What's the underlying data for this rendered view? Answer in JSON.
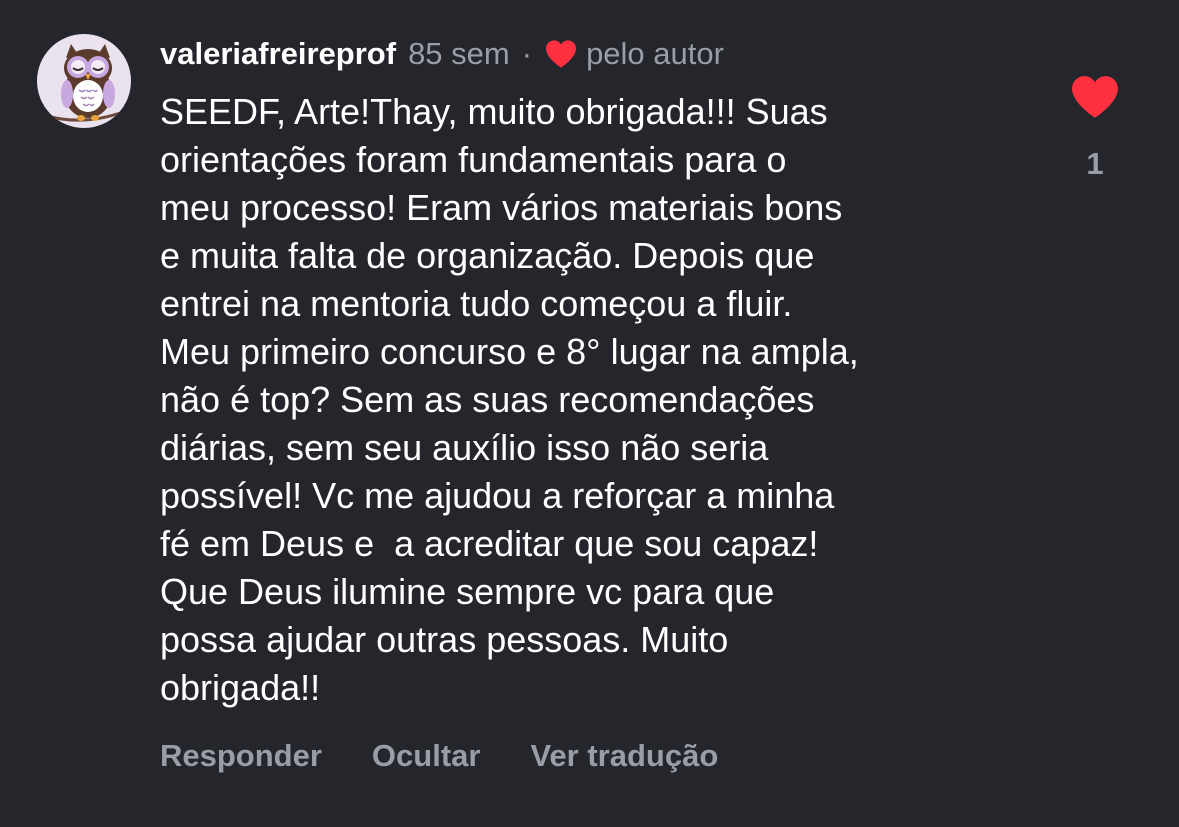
{
  "comment": {
    "username": "valeriafreireprof",
    "time": "85 sem",
    "separator": "·",
    "liked_by_author_label": "pelo autor",
    "text": "SEEDF, Arte!Thay, muito obrigada!!! Suas\norientações foram fundamentais para o\nmeu processo! Eram vários materiais bons\ne muita falta de organização. Depois que\nentrei na mentoria tudo começou a fluir.\nMeu primeiro concurso e 8° lugar na ampla,\nnão é top? Sem as suas recomendações\ndiárias, sem seu auxílio isso não seria\npossível! Vc me ajudou a reforçar a minha\nfé em Deus e  a acreditar que sou capaz!\nQue Deus ilumine sempre vc para que\npossa ajudar outras pessoas. Muito\nobrigada!!",
    "like_count": "1",
    "liked": true
  },
  "actions": {
    "reply_label": "Responder",
    "hide_label": "Ocultar",
    "translate_label": "Ver tradução"
  },
  "icons": {
    "avatar": "owl-avatar-icon",
    "author_like": "heart-filled-icon",
    "like": "heart-filled-icon"
  },
  "colors": {
    "background": "#24262c",
    "text_primary": "#ffffff",
    "text_secondary": "#9a9ca6",
    "heart": "#ff3040",
    "avatar_bg": "#ebe2ef"
  }
}
